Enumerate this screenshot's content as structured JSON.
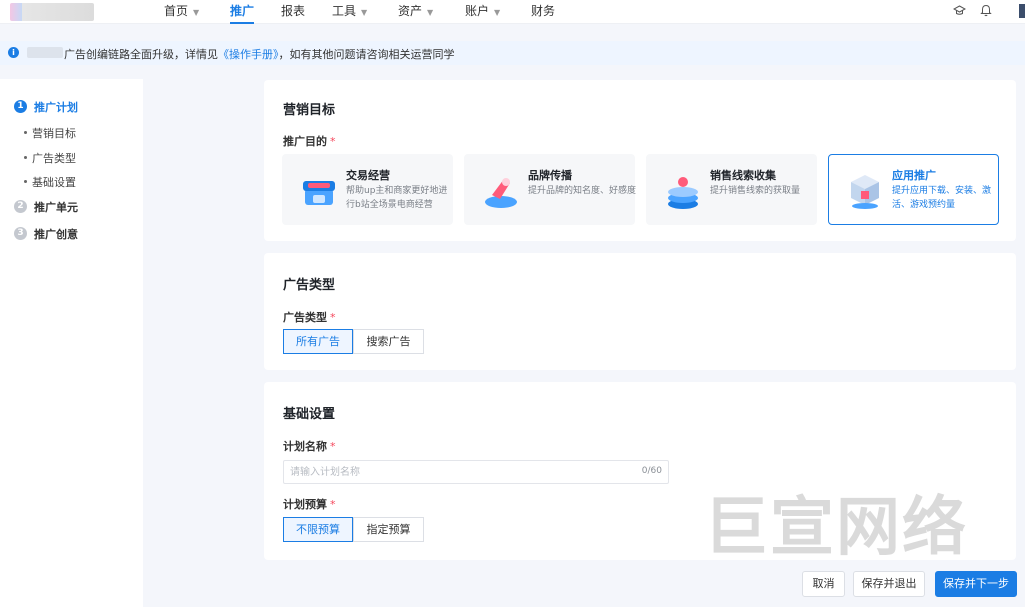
{
  "nav": {
    "items": [
      {
        "label": "首页",
        "has_caret": true
      },
      {
        "label": "推广",
        "has_caret": false,
        "active": true
      },
      {
        "label": "报表",
        "has_caret": false
      },
      {
        "label": "工具",
        "has_caret": true
      },
      {
        "label": "资产",
        "has_caret": true
      },
      {
        "label": "账户",
        "has_caret": true
      },
      {
        "label": "财务",
        "has_caret": false
      }
    ],
    "icons": [
      "graduation-cap-icon",
      "bell-icon"
    ]
  },
  "notice": {
    "text_before": "广告创编链路全面升级，详情见",
    "link": "《操作手册》",
    "text_after": "，如有其他问题请咨询相关运营同学"
  },
  "steps": [
    {
      "num": "1",
      "label": "推广计划",
      "active": true
    },
    {
      "num": "2",
      "label": "推广单元",
      "active": false
    },
    {
      "num": "3",
      "label": "推广创意",
      "active": false
    }
  ],
  "substeps": [
    "营销目标",
    "广告类型",
    "基础设置"
  ],
  "marketing": {
    "title": "营销目标",
    "field_label": "推广目的",
    "required_mark": "*",
    "goals": [
      {
        "title": "交易经营",
        "desc": "帮助up主和商家更好地进行b站全场景电商经营",
        "selected": false,
        "icon": "shop-icon"
      },
      {
        "title": "品牌传播",
        "desc": "提升品牌的知名度、好感度",
        "selected": false,
        "icon": "megaphone-icon"
      },
      {
        "title": "销售线索收集",
        "desc": "提升销售线索的获取量",
        "selected": false,
        "icon": "funnel-icon"
      },
      {
        "title": "应用推广",
        "desc": "提升应用下载、安装、激活、游戏预约量",
        "selected": true,
        "icon": "app-cube-icon"
      }
    ]
  },
  "ad_type": {
    "title": "广告类型",
    "field_label": "广告类型",
    "options": [
      {
        "label": "所有广告",
        "active": true
      },
      {
        "label": "搜索广告",
        "active": false
      }
    ]
  },
  "basic": {
    "title": "基础设置",
    "name_label": "计划名称",
    "name_placeholder": "请输入计划名称",
    "name_counter": "0/60",
    "budget_label": "计划预算",
    "budget_options": [
      {
        "label": "不限预算",
        "active": true
      },
      {
        "label": "指定预算",
        "active": false
      }
    ]
  },
  "footer": {
    "cancel": "取消",
    "save_exit": "保存并退出",
    "save_next": "保存并下一步"
  },
  "watermark": "巨宣网络",
  "colors": {
    "accent": "#1b7de4",
    "required": "#f5475b"
  }
}
